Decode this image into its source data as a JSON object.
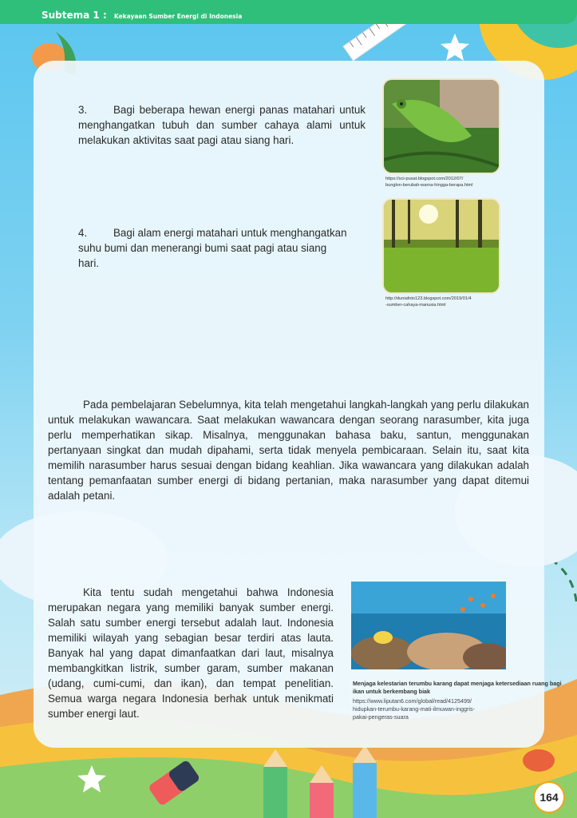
{
  "header": {
    "subtheme_label": "Subtema 1 :",
    "subtheme_title": "Kekayaan Sumber Energi di Indonesia"
  },
  "items": [
    {
      "number": "3.",
      "text": "Bagi beberapa hewan energi panas matahari untuk menghangatkan tubuh dan sumber cahaya alami untuk melakukan aktivitas saat pagi atau siang hari.",
      "image_subject": "chameleon",
      "source_lines": [
        "https://sci-pusat.blogspot.com/2012/07/",
        "bunglon-berubah-warna-hingga-berapa.html"
      ]
    },
    {
      "number": "4.",
      "text": "Bagi alam energi matahari untuk menghangatkan suhu bumi dan menerangi bumi saat pagi atau siang hari.",
      "image_subject": "sunlight-in-forest",
      "source_lines": [
        "http://duniafoto123.blogspot.com/2019/01/4",
        "-sumber-cahaya-manusia.html"
      ]
    }
  ],
  "paragraph_interview": "Pada pembelajaran Sebelumnya, kita telah mengetahui langkah-langkah yang perlu dilakukan untuk melakukan wawancara. Saat melakukan wawancara dengan seorang narasumber, kita juga perlu memperhatikan sikap. Misalnya, menggunakan bahasa baku, santun, menggunakan pertanyaan singkat dan mudah dipahami, serta tidak menyela pembicaraan. Selain itu, saat kita memilih narasumber harus sesuai dengan bidang keahlian. Jika wawancara yang dilakukan adalah tentang pemanfaatan sumber energi di bidang pertanian, maka narasumber yang dapat ditemui adalah petani.",
  "paragraph_sea": "Kita tentu sudah mengetahui bahwa Indonesia merupakan negara yang memiliki banyak sumber energi. Salah satu sumber energi tersebut adalah laut. Indonesia memiliki wilayah yang sebagian besar terdiri atas lauta. Banyak hal yang dapat dimanfaatkan dari laut, misalnya membangkitkan listrik, sumber garam, sumber makanan (udang, cumi-cumi, dan ikan), dan tempat penelitian. Semua warga negara Indonesia berhak untuk menikmati sumber energi laut.",
  "coral_caption": {
    "bold": "Menjaga kelestarian terumbu karang dapat menjaga ketersediaan ruang bagi ikan untuk berkembang biak",
    "link_lines": [
      "https://www.liputan6.com/global/read/4125499/",
      "hidupkan-terumbu-karang-mati-ilmuwan-inggris-",
      "pakai-pengeras-suara"
    ]
  },
  "page_number": "164",
  "colors": {
    "header_green": "#2fbf7a",
    "sky_blue": "#5bc6ef",
    "card_bg": "#f0f9fd",
    "page_number_ring": "#f2a51a"
  }
}
